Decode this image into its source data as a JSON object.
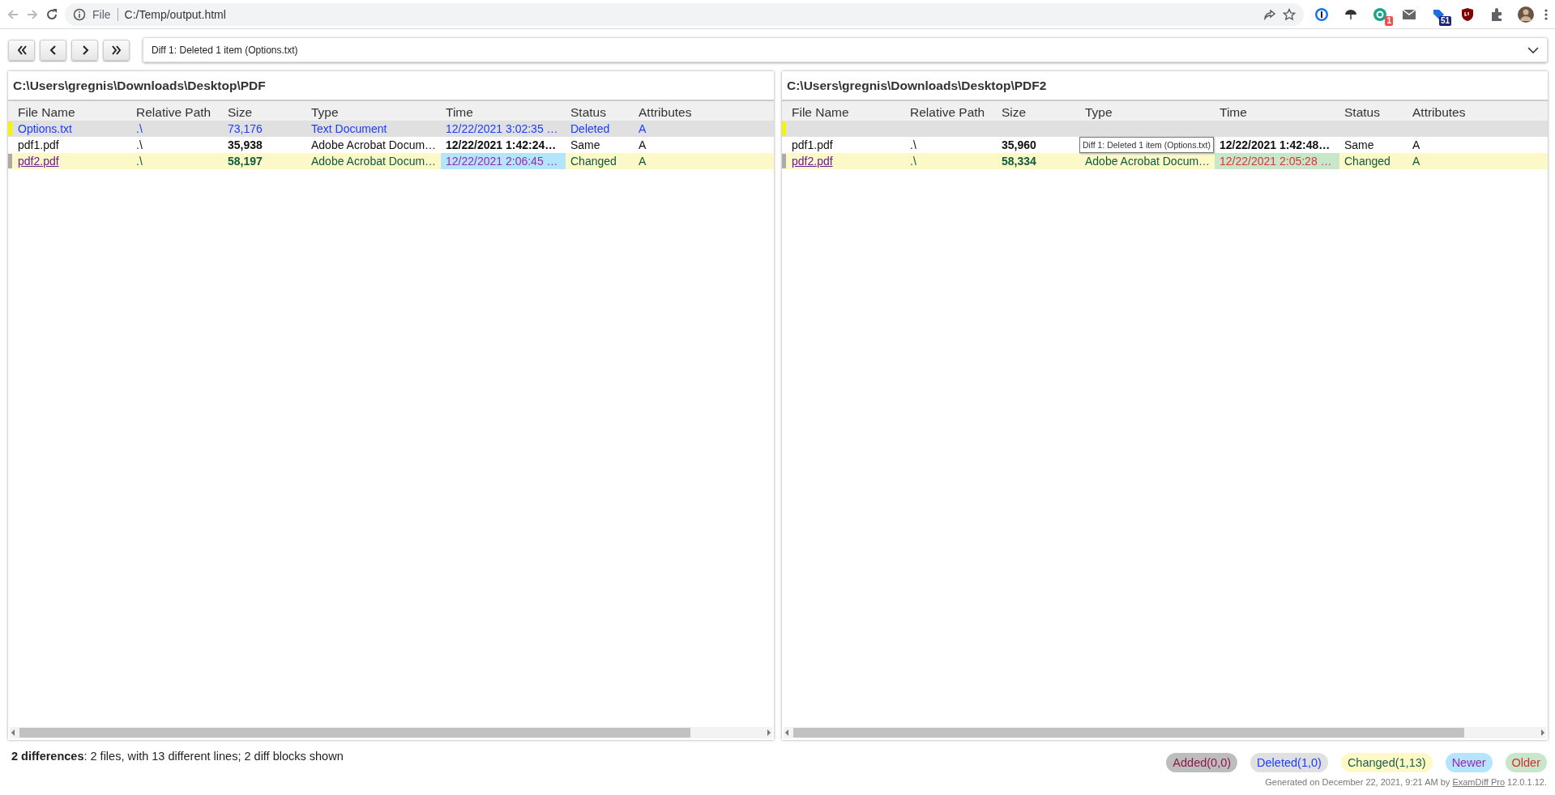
{
  "browser": {
    "scheme": "File",
    "url": "C:/Temp/output.html",
    "extensions": [
      {
        "kind": "password"
      },
      {
        "kind": "umbrella"
      },
      {
        "kind": "letter",
        "badge": "1"
      },
      {
        "kind": "mail"
      },
      {
        "kind": "tag",
        "badge": "51"
      },
      {
        "kind": "shield"
      },
      {
        "kind": "puzzle"
      },
      {
        "kind": "avatar"
      }
    ]
  },
  "toolbar": {
    "buttons": [
      {
        "kind": "first"
      },
      {
        "kind": "prev"
      },
      {
        "kind": "next"
      },
      {
        "kind": "last"
      }
    ],
    "diff_select": "Diff 1: Deleted 1 item (Options.txt)"
  },
  "panels": [
    {
      "title": "C:\\Users\\gregnis\\Downloads\\Desktop\\PDF",
      "columns": [
        "File Name",
        "Relative Path",
        "Size",
        "Type",
        "Time",
        "Status",
        "Attributes"
      ],
      "rows": [
        {
          "kind": "deleted",
          "name": "Options.txt",
          "path": ".\\",
          "size": "73,176",
          "type": "Text Document",
          "time": {
            "kind": "plain",
            "text": "12/22/2021 3:02:35 …"
          },
          "status": "Deleted",
          "attributes": "A"
        },
        {
          "kind": "same",
          "name": "pdf1.pdf",
          "path": ".\\",
          "size": "35,938",
          "type": "Adobe Acrobat Docum…",
          "time": {
            "kind": "plain",
            "text": "12/22/2021 1:42:24…"
          },
          "status": "Same",
          "attributes": "A"
        },
        {
          "kind": "changed",
          "name": "pdf2.pdf",
          "path": ".\\",
          "size": "58,197",
          "type": "Adobe Acrobat Docum…",
          "time": {
            "kind": "newer",
            "text": "12/22/2021 2:06:45 …"
          },
          "status": "Changed",
          "attributes": "A"
        }
      ]
    },
    {
      "title": "C:\\Users\\gregnis\\Downloads\\Desktop\\PDF2",
      "columns": [
        "File Name",
        "Relative Path",
        "Size",
        "Type",
        "Time",
        "Status",
        "Attributes"
      ],
      "tooltip": "Diff 1: Deleted 1 item (Options.txt)",
      "rows": [
        {
          "kind": "gap"
        },
        {
          "kind": "same",
          "name": "pdf1.pdf",
          "path": ".\\",
          "size": "35,960",
          "time": {
            "kind": "plain",
            "text": "12/22/2021 1:42:48…"
          },
          "status": "Same",
          "attributes": "A"
        },
        {
          "kind": "changed",
          "name": "pdf2.pdf",
          "path": ".\\",
          "size": "58,334",
          "type": "Adobe Acrobat Docum…",
          "time": {
            "kind": "older",
            "text": "12/22/2021 2:05:28 …"
          },
          "status": "Changed",
          "attributes": "A"
        }
      ]
    }
  ],
  "summary": "**2 differences**: 2 files, with 13 different lines; 2 diff blocks shown",
  "legend": [
    {
      "kind": "added",
      "label": "Added(0,0)"
    },
    {
      "kind": "deleted",
      "label": "Deleted(1,0)"
    },
    {
      "kind": "changed",
      "label": "Changed(1,13)"
    },
    {
      "kind": "newer",
      "label": "Newer"
    },
    {
      "kind": "older",
      "label": "Older"
    }
  ],
  "generated": {
    "prefix": "Generated on December 22, 2021, 9:21 AM by",
    "link": "ExamDiff Pro",
    "suffix": "12.0.1.12."
  }
}
